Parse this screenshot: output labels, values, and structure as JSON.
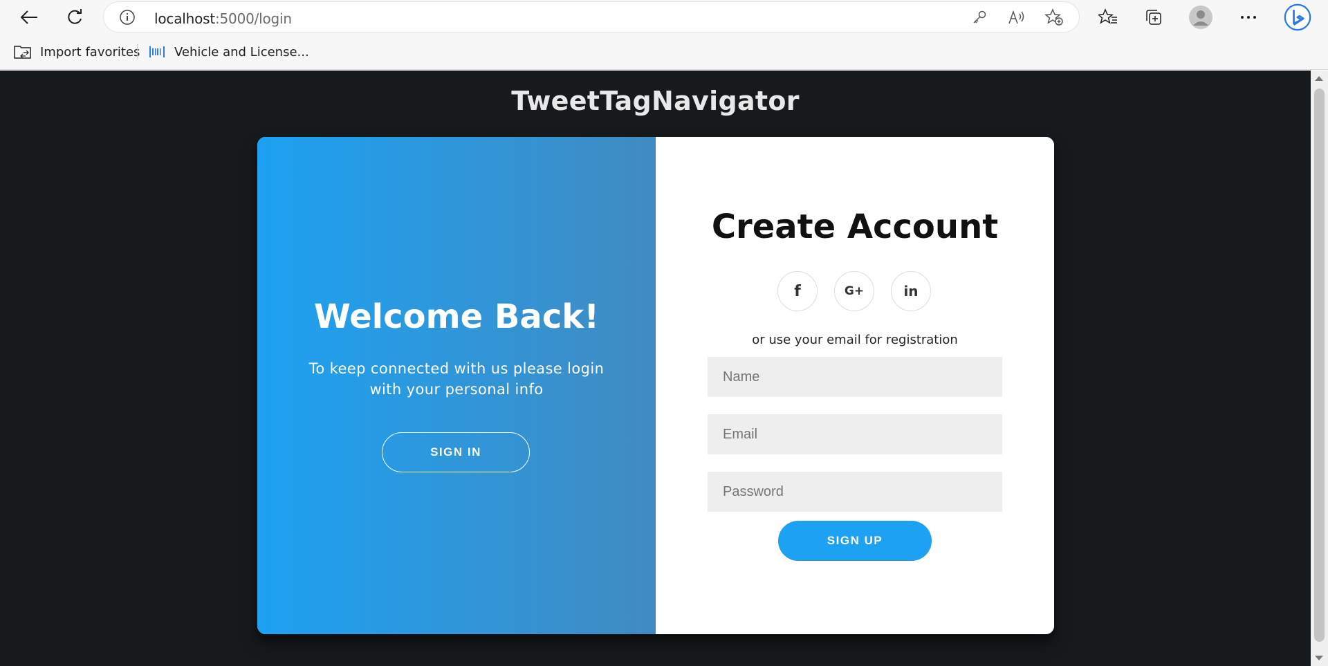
{
  "browser": {
    "url_host": "localhost",
    "url_rest": ":5000/login",
    "bookmarks": [
      {
        "label": "Import favorites"
      },
      {
        "label": "Vehicle and License..."
      }
    ]
  },
  "app": {
    "title": "TweetTagNavigator"
  },
  "overlay": {
    "title": "Welcome Back!",
    "text": "To keep connected with us please login with your personal info",
    "button_label": "SIGN IN"
  },
  "signup": {
    "title": "Create Account",
    "social": {
      "facebook": "f",
      "google": "G+",
      "linkedin": "in"
    },
    "subtext": "or use your email for registration",
    "name_placeholder": "Name",
    "email_placeholder": "Email",
    "password_placeholder": "Password",
    "button_label": "SIGN UP"
  },
  "colors": {
    "accent": "#1da1f2",
    "gradient_end": "#418bc1",
    "page_bg": "#171a1d"
  }
}
